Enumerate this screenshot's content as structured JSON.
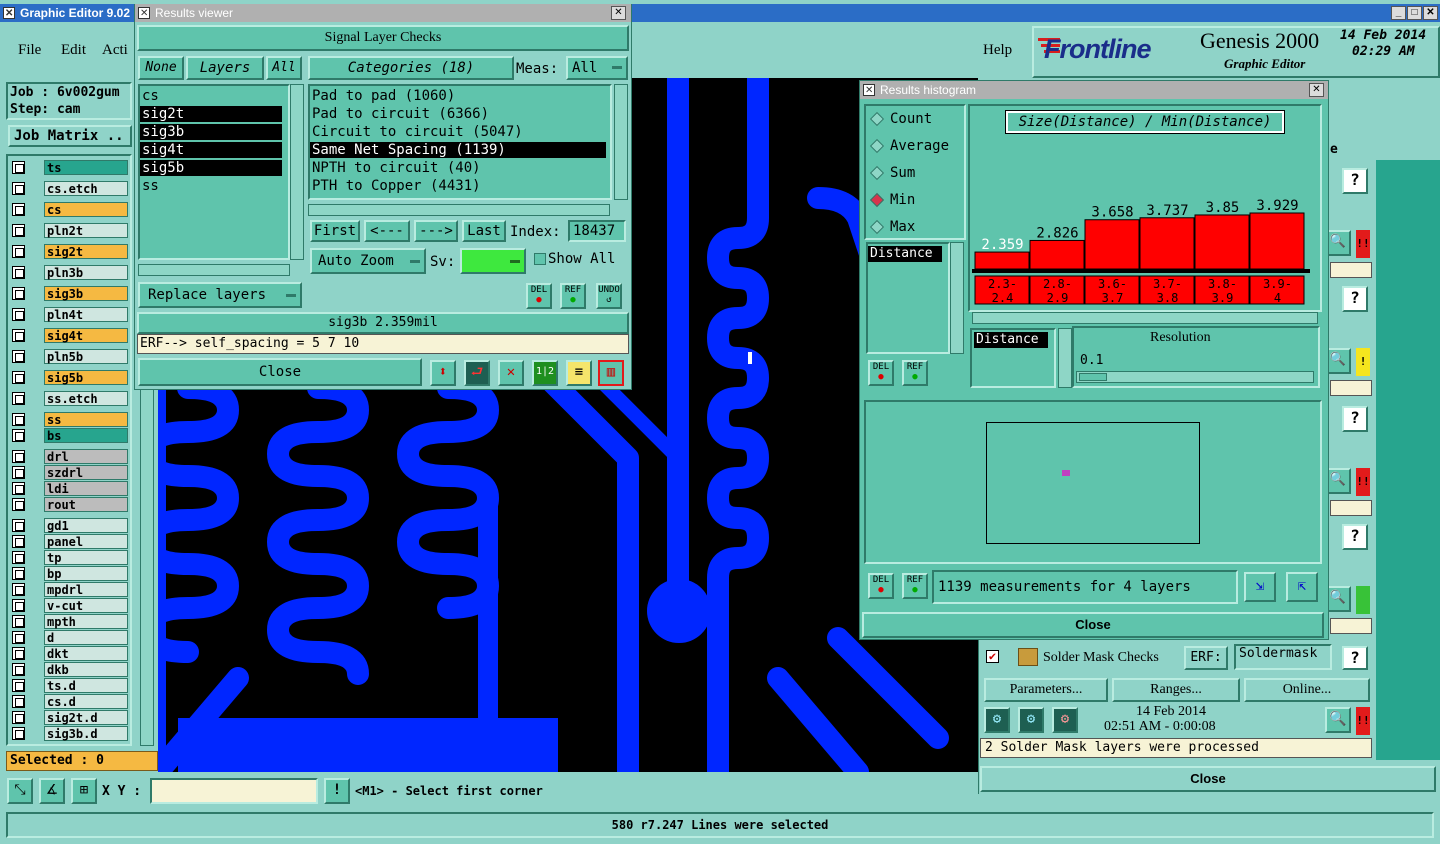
{
  "app": {
    "title": "Graphic Editor 9.02",
    "menu": [
      "File",
      "Edit",
      "Acti"
    ],
    "help": "Help",
    "brand": "Frontline",
    "product": "Genesis 2000",
    "product_sub": "Graphic Editor",
    "date": "14 Feb 2014",
    "time": "02:29 AM",
    "job": "Job : 6v002gum",
    "step": "Step: cam",
    "job_matrix": "Job Matrix ..",
    "selected": "Selected : 0",
    "xy_label": "X Y :",
    "xy_value": "",
    "prompt": "<M1> - Select first corner",
    "status": "580 r7.247 Lines were selected"
  },
  "layers": [
    {
      "name": "ts",
      "color": "#27a58e"
    },
    {
      "name": "cs.etch",
      "color": "#cfe6e0"
    },
    {
      "name": "cs",
      "color": "#f5b942"
    },
    {
      "name": "pln2t",
      "color": "#cfe6e0"
    },
    {
      "name": "sig2t",
      "color": "#f5b942"
    },
    {
      "name": "pln3b",
      "color": "#cfe6e0"
    },
    {
      "name": "sig3b",
      "color": "#f5b942"
    },
    {
      "name": "pln4t",
      "color": "#cfe6e0"
    },
    {
      "name": "sig4t",
      "color": "#f5b942"
    },
    {
      "name": "pln5b",
      "color": "#cfe6e0"
    },
    {
      "name": "sig5b",
      "color": "#f5b942"
    },
    {
      "name": "ss.etch",
      "color": "#cfe6e0"
    },
    {
      "name": "ss",
      "color": "#f5b942"
    },
    {
      "name": "bs",
      "color": "#27a58e"
    },
    {
      "name": "drl",
      "color": "#bcbcbc"
    },
    {
      "name": "szdrl",
      "color": "#bcbcbc"
    },
    {
      "name": "ldi",
      "color": "#bcbcbc"
    },
    {
      "name": "rout",
      "color": "#bcbcbc"
    },
    {
      "name": "gd1",
      "color": "#cfe6e0"
    },
    {
      "name": "panel",
      "color": "#cfe6e0"
    },
    {
      "name": "tp",
      "color": "#cfe6e0"
    },
    {
      "name": "bp",
      "color": "#cfe6e0"
    },
    {
      "name": "mpdrl",
      "color": "#cfe6e0"
    },
    {
      "name": "v-cut",
      "color": "#cfe6e0"
    },
    {
      "name": "mpth",
      "color": "#cfe6e0"
    },
    {
      "name": "d",
      "color": "#cfe6e0"
    },
    {
      "name": "dkt",
      "color": "#cfe6e0"
    },
    {
      "name": "dkb",
      "color": "#cfe6e0"
    },
    {
      "name": "ts.d",
      "color": "#cfe6e0"
    },
    {
      "name": "cs.d",
      "color": "#cfe6e0"
    },
    {
      "name": "sig2t.d",
      "color": "#cfe6e0"
    },
    {
      "name": "sig3b.d",
      "color": "#cfe6e0"
    }
  ],
  "results_viewer": {
    "title": "Results viewer",
    "heading": "Signal Layer Checks",
    "none": "None",
    "layers": "Layers",
    "all": "All",
    "categories": "Categories (18)",
    "meas_label": "Meas:",
    "meas_value": "All",
    "layer_list": [
      {
        "name": "cs",
        "selected": false
      },
      {
        "name": "sig2t",
        "selected": true
      },
      {
        "name": "sig3b",
        "selected": true
      },
      {
        "name": "sig4t",
        "selected": true
      },
      {
        "name": "sig5b",
        "selected": true
      },
      {
        "name": "ss",
        "selected": false
      }
    ],
    "category_list": [
      {
        "name": "Pad to pad (1060)",
        "selected": false
      },
      {
        "name": "Pad to circuit (6366)",
        "selected": false
      },
      {
        "name": "Circuit to circuit (5047)",
        "selected": false
      },
      {
        "name": "Same Net Spacing (1139)",
        "selected": true
      },
      {
        "name": "NPTH to circuit (40)",
        "selected": false
      },
      {
        "name": "PTH to Copper (4431)",
        "selected": false
      }
    ],
    "first": "First",
    "prev": "<---",
    "next": "--->",
    "last": "Last",
    "index_label": "Index:",
    "index_value": "18437",
    "auto_zoom": "Auto Zoom",
    "sv": "Sv:",
    "show_all": "Show All",
    "replace_layers": "Replace layers",
    "del": "DEL",
    "ref": "REF",
    "undo": "UNDO",
    "status": "sig3b 2.359mil",
    "erf": "ERF--> self_spacing = 5 7 10",
    "close": "Close"
  },
  "histogram": {
    "title": "Results histogram",
    "modes": [
      {
        "label": "Count",
        "selected": false
      },
      {
        "label": "Average",
        "selected": false
      },
      {
        "label": "Sum",
        "selected": false
      },
      {
        "label": "Min",
        "selected": true
      },
      {
        "label": "Max",
        "selected": false
      }
    ],
    "chart_title": "Size(Distance) / Min(Distance)",
    "distance": "Distance",
    "resolution_label": "Resolution",
    "resolution_value": "0.1",
    "del": "DEL",
    "ref": "REF",
    "summary": "1139 measurements for 4 layers",
    "close": "Close"
  },
  "chart_data": {
    "type": "bar",
    "title": "Size(Distance) / Min(Distance)",
    "categories": [
      "2.3-2.4",
      "2.8-2.9",
      "3.6-3.7",
      "3.7-3.8",
      "3.8-3.9",
      "3.9-4"
    ],
    "values": [
      2.359,
      2.826,
      3.658,
      3.737,
      3.85,
      3.929
    ],
    "value_labels": [
      "2.359",
      "2.826",
      "3.658",
      "3.737",
      "3.85",
      "3.929"
    ],
    "bar_color": "#ff0000"
  },
  "side_checks": {
    "name": "Solder Mask Checks",
    "erf": "ERF:",
    "erf_value": "Soldermask",
    "parameters": "Parameters...",
    "ranges": "Ranges...",
    "online": "Online...",
    "date": "14 Feb 2014",
    "time": "02:51 AM - 0:00:08",
    "message": "2 Solder Mask layers were processed",
    "close": "Close",
    "q": "?",
    "e_partial": "e"
  }
}
